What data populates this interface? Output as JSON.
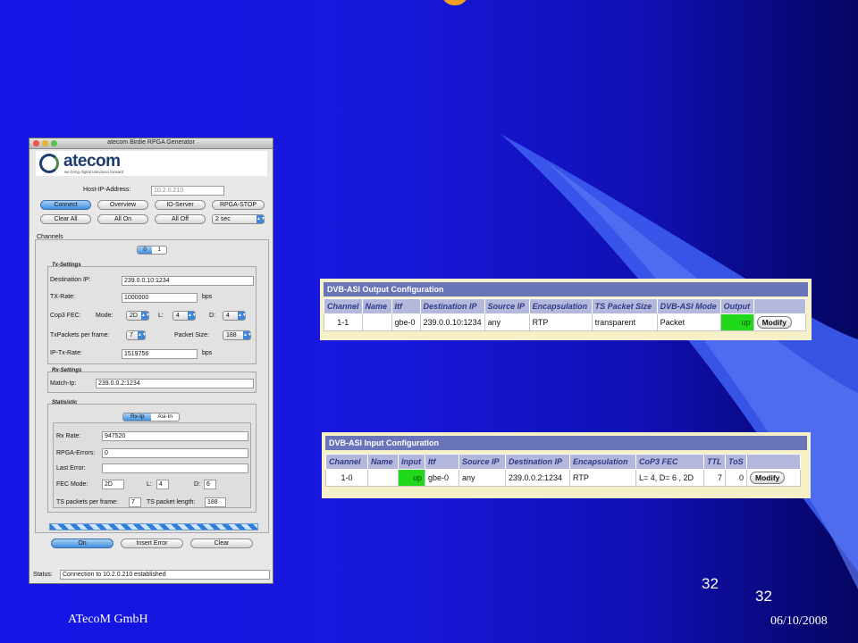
{
  "app": {
    "window_title": "atecom Birdie RPGA Generator",
    "logo": {
      "name": "atecom",
      "tagline": "we bring digital television forward"
    },
    "host_ip_label": "Host-IP-Address:",
    "host_ip_value": "10.2.0.210",
    "buttons_row1": [
      "Connect",
      "Overview",
      "IO-Server",
      "RPGA-STOP"
    ],
    "buttons_row2": [
      "Clear All",
      "All On",
      "All Off"
    ],
    "interval_value": "2 sec",
    "channels_label": "Channels",
    "channel_tabs": [
      "0",
      "1"
    ],
    "tx": {
      "title": "Tx-Settings",
      "dest_ip_label": "Destination IP:",
      "dest_ip_value": "239.0.0.10:1234",
      "tx_rate_label": "TX-Rate:",
      "tx_rate_value": "1000000",
      "tx_rate_unit": "bps",
      "fec_label": "Cop3 FEC:",
      "mode_label": "Mode:",
      "mode_value": "2D",
      "l_label": "L:",
      "l_value": "4",
      "d_label": "D:",
      "d_value": "4",
      "packets_label": "TxPackets per frame:",
      "packets_value": "7",
      "packet_size_label": "Packet Size:",
      "packet_size_value": "188",
      "ip_tx_rate_label": "IP-Tx-Rate:",
      "ip_tx_rate_value": "1519756",
      "ip_tx_rate_unit": "bps"
    },
    "rx": {
      "title": "Rx-Settings",
      "match_ip_label": "Match-Ip:",
      "match_ip_value": "239.0.0.2:1234"
    },
    "stats": {
      "title": "Statisistic",
      "tabs": [
        "Rx-Ip",
        "Asi-In"
      ],
      "rx_rate_label": "Rx Rate:",
      "rx_rate_value": "947520",
      "rpga_errors_label": "RPGA-Errors:",
      "rpga_errors_value": "0",
      "last_error_label": "Last Error:",
      "last_error_value": "",
      "fec_mode_label": "FEC Mode:",
      "fec_mode_value": "2D",
      "l_label": "L:",
      "l_value": "4",
      "d_label": "D:",
      "d_value": "6",
      "ts_ppf_label": "TS packets per frame:",
      "ts_ppf_value": "7",
      "ts_len_label": "TS packet length:",
      "ts_len_value": "188"
    },
    "progress_fraction": 1.0,
    "bottom_buttons": [
      "On",
      "Insert Error",
      "Clear"
    ],
    "status_label": "Status:",
    "status_value": "Connection to 10.2.0.210 established"
  },
  "output_config": {
    "title": "DVB-ASI Output Configuration",
    "columns": [
      "Channel",
      "Name",
      "Itf",
      "Destination IP",
      "Source IP",
      "Encapsulation",
      "TS Packet Size",
      "DVB-ASI Mode",
      "Output",
      ""
    ],
    "row": [
      "1-1",
      "",
      "gbe-0",
      "239.0.0.10:1234",
      "any",
      "RTP",
      "transparent",
      "Packet",
      "up"
    ],
    "action": "Modify"
  },
  "input_config": {
    "title": "DVB-ASI Input Configuration",
    "columns": [
      "Channel",
      "Name",
      "Input",
      "Itf",
      "Source IP",
      "Destination IP",
      "Encapsulation",
      "CoP3 FEC",
      "TTL",
      "ToS",
      ""
    ],
    "row": [
      "1-0",
      "",
      "up",
      "gbe-0",
      "any",
      "239.0.0.2:1234",
      "RTP",
      "L= 4, D= 6 , 2D",
      "7",
      "0"
    ],
    "action": "Modify"
  },
  "slide": {
    "number_a": "32",
    "number_b": "32",
    "company": "ATecoM GmbH",
    "date": "06/10/2008"
  },
  "colors": {
    "background": "#1414e6",
    "swoosh": "#4a64ee",
    "status_up": "#22d81a",
    "table_header": "#6a74b8"
  }
}
